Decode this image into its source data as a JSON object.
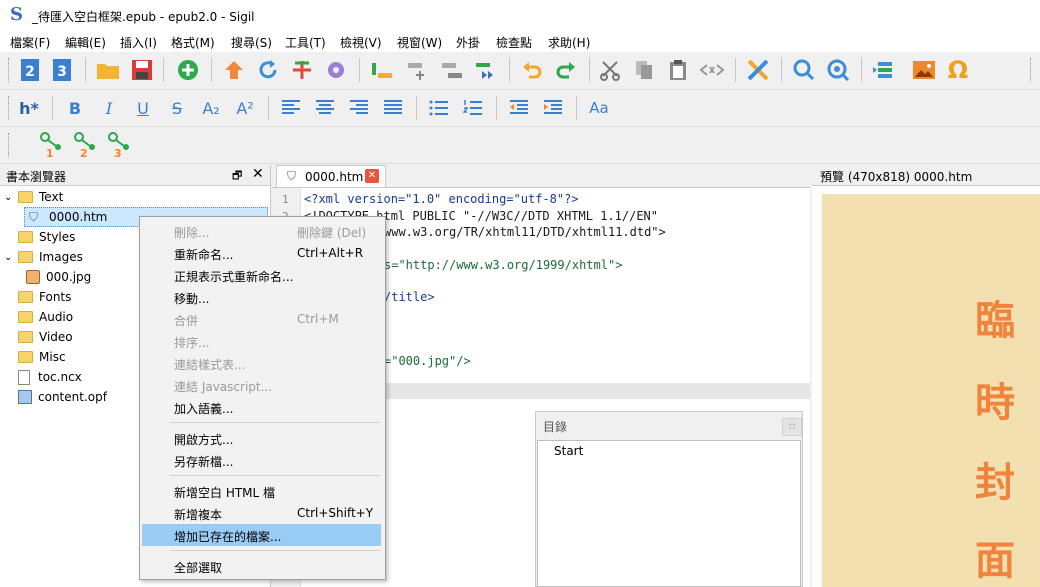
{
  "window": {
    "app_logo": "S",
    "title": "_待匯入空白框架.epub - epub2.0 - Sigil"
  },
  "menu": [
    "檔案(F)",
    "編輯(E)",
    "插入(I)",
    "格式(M)",
    "搜尋(S)",
    "工具(T)",
    "檢視(V)",
    "視窗(W)",
    "外掛",
    "檢查點",
    "求助(H)"
  ],
  "toolbar": {
    "icons_row1": [
      "epub2-icon",
      "epub3-icon",
      "open-icon",
      "save-icon",
      "add-icon",
      "upload-icon",
      "refresh-icon",
      "split-icon",
      "gear-icon",
      "insert-before-icon",
      "insert-after-icon",
      "remove-icon",
      "move-icon",
      "undo-icon",
      "redo-icon",
      "cut-icon",
      "copy-icon",
      "paste-icon",
      "code-icon",
      "x-icon",
      "search-icon",
      "search-zoom-icon",
      "tidy-icon",
      "image-icon",
      "omega-icon"
    ],
    "row1_labels": {
      "epub2": "2",
      "epub3": "3",
      "omega": "Ω",
      "overflow": "»"
    },
    "row2_labels": {
      "heading": "h*",
      "bold": "B",
      "italic": "I",
      "underline": "U",
      "strike": "S",
      "sub": "A₂",
      "sup": "A²",
      "case": "Aa"
    },
    "row3_labels": [
      "1",
      "2",
      "3"
    ]
  },
  "book_browser": {
    "title": "書本瀏覽器",
    "tree": [
      {
        "label": "Text",
        "type": "folder",
        "expanded": true
      },
      {
        "label": "0000.htm",
        "type": "file",
        "selected": true
      },
      {
        "label": "Styles",
        "type": "folder"
      },
      {
        "label": "Images",
        "type": "folder",
        "expanded": true
      },
      {
        "label": "000.jpg",
        "type": "image"
      },
      {
        "label": "Fonts",
        "type": "folder"
      },
      {
        "label": "Audio",
        "type": "folder"
      },
      {
        "label": "Video",
        "type": "folder"
      },
      {
        "label": "Misc",
        "type": "folder"
      },
      {
        "label": "toc.ncx",
        "type": "file"
      },
      {
        "label": "content.opf",
        "type": "file"
      }
    ]
  },
  "editor": {
    "tab_label": "0000.htm",
    "line_numbers": [
      "1",
      "2"
    ],
    "lines": [
      "<?xml version=\"1.0\" encoding=\"utf-8\"?>",
      "<!DOCTYPE html PUBLIC \"-//W3C//DTD XHTML 1.1//EN\"",
      "www.w3.org/TR/xhtml11/DTD/xhtml11.dtd\">",
      "s=\"http://www.w3.org/1999/xhtml\">",
      "/title>",
      "=\"000.jpg\"/>"
    ]
  },
  "preview": {
    "title": "預覽 (470x818) 0000.htm",
    "cover_chars": [
      "臨",
      "時",
      "封",
      "面"
    ]
  },
  "toc": {
    "title": "目錄",
    "items": [
      "Start"
    ]
  },
  "context_menu": [
    {
      "label": "刪除...",
      "shortcut": "刪除鍵 (Del)",
      "disabled": true
    },
    {
      "label": "重新命名...",
      "shortcut": "Ctrl+Alt+R"
    },
    {
      "label": "正規表示式重新命名..."
    },
    {
      "label": "移動..."
    },
    {
      "label": "合併",
      "shortcut": "Ctrl+M",
      "disabled": true
    },
    {
      "label": "排序...",
      "disabled": true
    },
    {
      "label": "連結樣式表...",
      "disabled": true
    },
    {
      "label": "連結 Javascript...",
      "disabled": true
    },
    {
      "label": "加入語義..."
    },
    {
      "label": "開啟方式..."
    },
    {
      "label": "另存新檔..."
    },
    {
      "label": "新增空白 HTML 檔"
    },
    {
      "label": "新增複本",
      "shortcut": "Ctrl+Shift+Y"
    },
    {
      "label": "增加已存在的檔案...",
      "highlighted": true
    },
    {
      "label": "全部選取"
    }
  ],
  "colors": {
    "accent_blue": "#3a6fb5",
    "highlight": "#99ccf5",
    "cover_bg": "#f3e0b0",
    "cover_text": "#f0843c"
  }
}
